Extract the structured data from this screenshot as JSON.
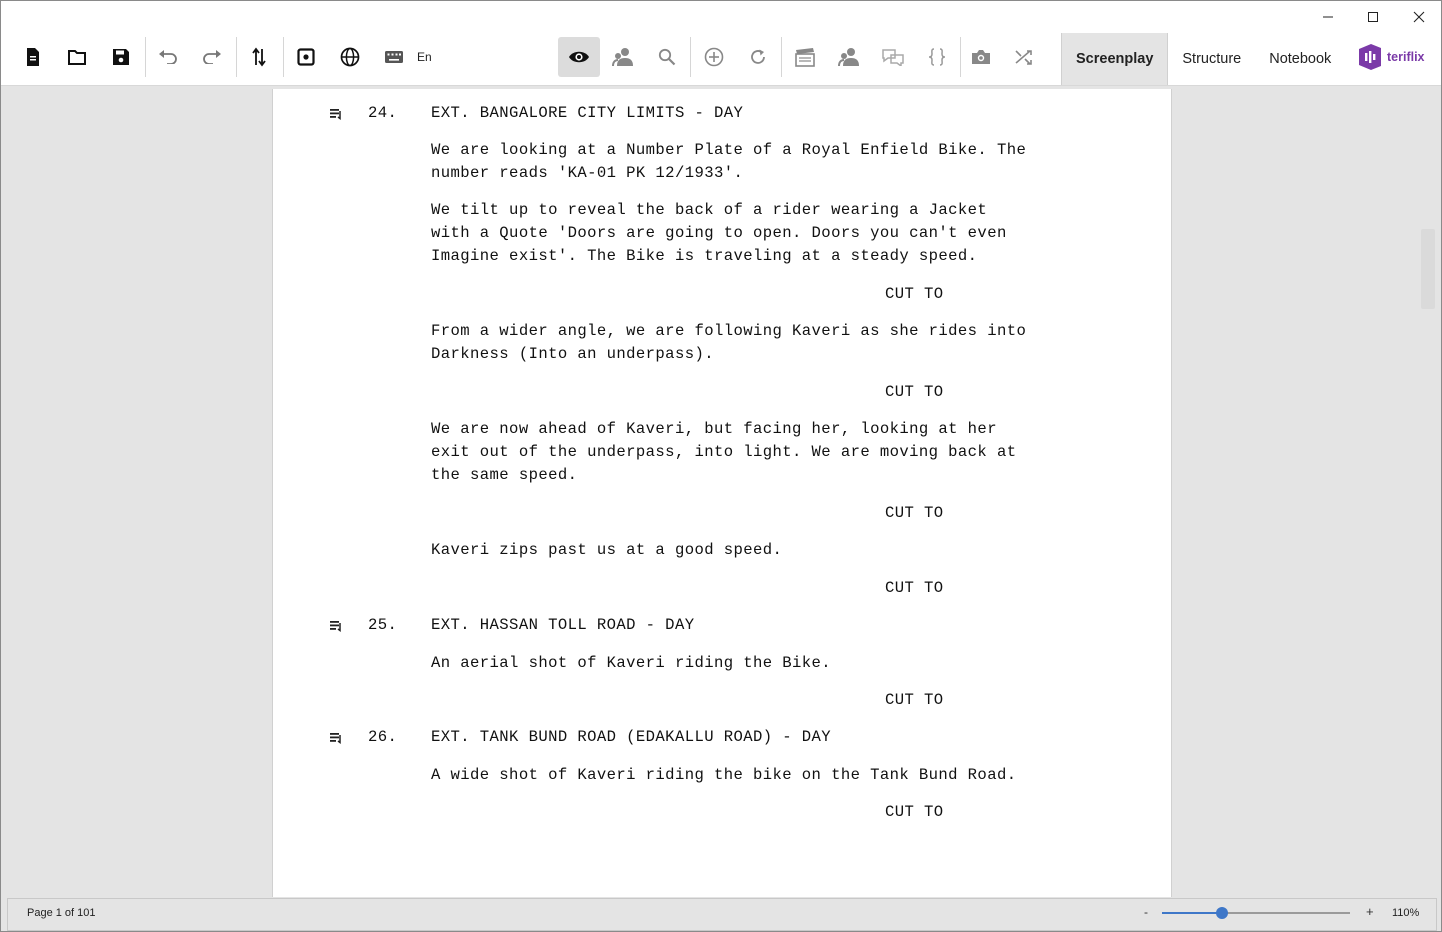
{
  "window": {
    "controls": [
      "minimize-icon",
      "maximize-icon",
      "close-icon"
    ]
  },
  "toolbar": {
    "language": "En",
    "tabs": [
      "Screenplay",
      "Structure",
      "Notebook"
    ],
    "active_tab": "Screenplay",
    "brand": "teriflix",
    "accent_color": "#7b3aa8"
  },
  "script": {
    "lines": [
      {
        "type": "heading",
        "number": "24.",
        "text": "EXT. BANGALORE CITY LIMITS - DAY"
      },
      {
        "type": "action",
        "text": "We are looking at a Number Plate of a Royal Enfield Bike. The\nnumber reads 'KA-01 PK 12/1933'."
      },
      {
        "type": "action",
        "text": "We tilt up to reveal the back of a rider wearing a Jacket\nwith a Quote 'Doors are going to open. Doors you can't even\nImagine exist'. The Bike is traveling at a steady speed."
      },
      {
        "type": "transition",
        "text": "CUT TO"
      },
      {
        "type": "action",
        "text": "From a wider angle, we are following Kaveri as she rides into\nDarkness (Into an underpass)."
      },
      {
        "type": "transition",
        "text": "CUT TO"
      },
      {
        "type": "action",
        "text": "We are now ahead of Kaveri, but facing her, looking at her\nexit out of the underpass, into light. We are moving back at\nthe same speed."
      },
      {
        "type": "transition",
        "text": "CUT TO"
      },
      {
        "type": "action",
        "text": "Kaveri zips past us at a good speed."
      },
      {
        "type": "transition",
        "text": "CUT TO"
      },
      {
        "type": "heading",
        "number": "25.",
        "text": "EXT. HASSAN TOLL ROAD - DAY"
      },
      {
        "type": "action",
        "text": "An aerial shot of Kaveri riding the Bike."
      },
      {
        "type": "transition",
        "text": "CUT TO"
      },
      {
        "type": "heading",
        "number": "26.",
        "text": "EXT. TANK BUND ROAD (EDAKALLU ROAD) - DAY"
      },
      {
        "type": "action",
        "text": "A wide shot of Kaveri riding the bike on the Tank Bund Road."
      },
      {
        "type": "transition",
        "text": "CUT TO"
      }
    ]
  },
  "status": {
    "page": "Page 1 of 101",
    "zoom_minus": "-",
    "zoom_plus": "+",
    "zoom_level": "110%",
    "zoom_fraction": 0.32
  }
}
